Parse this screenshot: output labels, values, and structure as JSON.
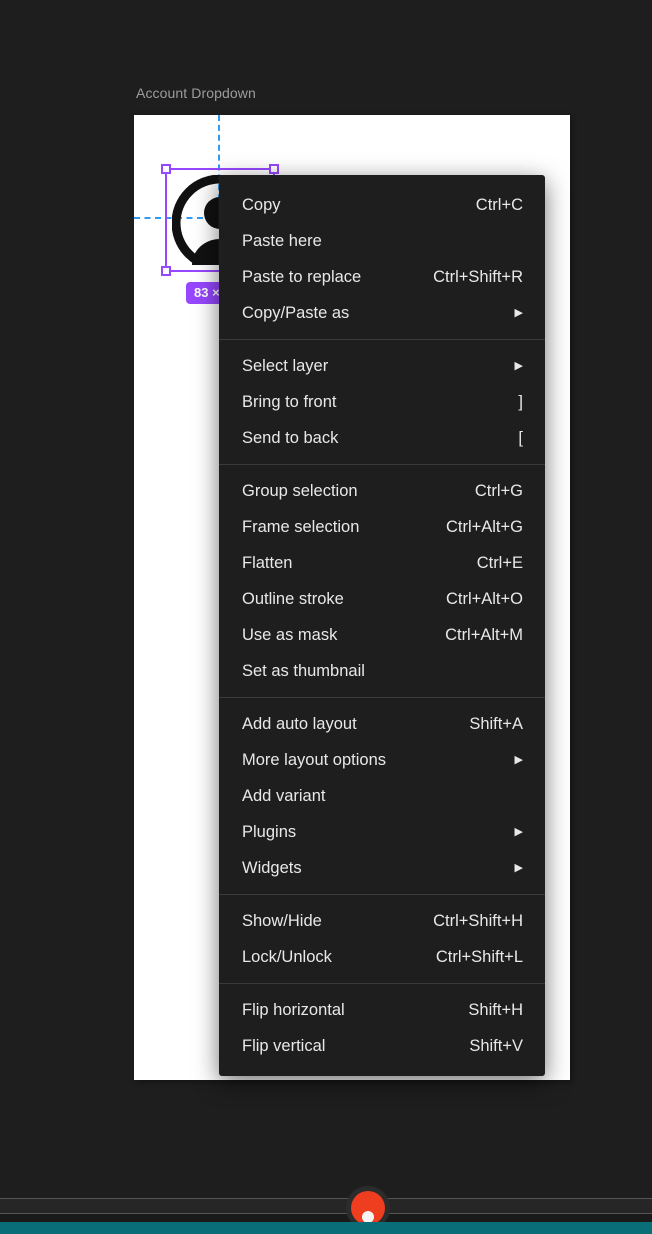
{
  "canvas": {
    "frame_label": "Account Dropdown",
    "background_color": "#1e1e1e",
    "frame_color": "#ffffff",
    "selection_color": "#9747ff",
    "guide_color": "#2f9bf5",
    "size_badge": "83 ×",
    "avatar_icon": "user-avatar-icon"
  },
  "context_menu": {
    "groups": [
      {
        "items": [
          {
            "label": "Copy",
            "shortcut": "Ctrl+C",
            "submenu": false
          },
          {
            "label": "Paste here",
            "shortcut": "",
            "submenu": false
          },
          {
            "label": "Paste to replace",
            "shortcut": "Ctrl+Shift+R",
            "submenu": false
          },
          {
            "label": "Copy/Paste as",
            "shortcut": "",
            "submenu": true
          }
        ]
      },
      {
        "items": [
          {
            "label": "Select layer",
            "shortcut": "",
            "submenu": true
          },
          {
            "label": "Bring to front",
            "shortcut": "]",
            "submenu": false
          },
          {
            "label": "Send to back",
            "shortcut": "[",
            "submenu": false
          }
        ]
      },
      {
        "items": [
          {
            "label": "Group selection",
            "shortcut": "Ctrl+G",
            "submenu": false
          },
          {
            "label": "Frame selection",
            "shortcut": "Ctrl+Alt+G",
            "submenu": false
          },
          {
            "label": "Flatten",
            "shortcut": "Ctrl+E",
            "submenu": false
          },
          {
            "label": "Outline stroke",
            "shortcut": "Ctrl+Alt+O",
            "submenu": false
          },
          {
            "label": "Use as mask",
            "shortcut": "Ctrl+Alt+M",
            "submenu": false
          },
          {
            "label": "Set as thumbnail",
            "shortcut": "",
            "submenu": false
          }
        ]
      },
      {
        "items": [
          {
            "label": "Add auto layout",
            "shortcut": "Shift+A",
            "submenu": false
          },
          {
            "label": "More layout options",
            "shortcut": "",
            "submenu": true
          },
          {
            "label": "Add variant",
            "shortcut": "",
            "submenu": false
          },
          {
            "label": "Plugins",
            "shortcut": "",
            "submenu": true
          },
          {
            "label": "Widgets",
            "shortcut": "",
            "submenu": true
          }
        ]
      },
      {
        "items": [
          {
            "label": "Show/Hide",
            "shortcut": "Ctrl+Shift+H",
            "submenu": false
          },
          {
            "label": "Lock/Unlock",
            "shortcut": "Ctrl+Shift+L",
            "submenu": false
          }
        ]
      },
      {
        "items": [
          {
            "label": "Flip horizontal",
            "shortcut": "Shift+H",
            "submenu": false
          },
          {
            "label": "Flip vertical",
            "shortcut": "Shift+V",
            "submenu": false
          }
        ]
      }
    ],
    "submenu_glyph": "▶"
  },
  "bottom_chrome": {
    "accent_color": "#0a6e78",
    "record_color": "#ef3d20",
    "record_icon": "record-button-icon"
  }
}
